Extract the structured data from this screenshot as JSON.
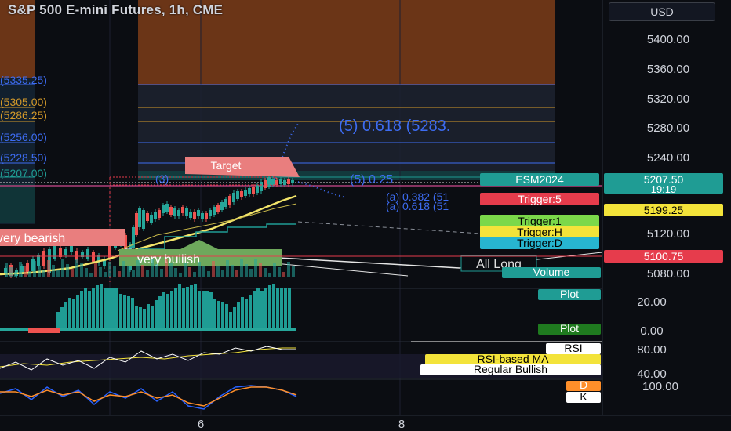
{
  "header": {
    "title": "S&P 500 E-mini Futures, 1h, CME",
    "currency_button": "USD"
  },
  "left_price_labels": [
    "(5335.25)",
    "(5305.00)",
    "(5286.25)",
    "(5256.00)",
    "(5228.50)",
    "(5207.00)"
  ],
  "fib_annotations": {
    "big_label": "(5) 0.618 (5283.",
    "cluster_label": "(3)",
    "label_025": "(5) 0.25",
    "label_a1": "(a) 0.382 (51",
    "label_a2": "(a) 0.618 (51"
  },
  "chart_labels": {
    "target": "Target",
    "very_bearish": "very bearish",
    "very_bullish": "very bullish",
    "all_long": "All Long"
  },
  "right_axis": {
    "price_ticks": [
      "5400.00",
      "5360.00",
      "5320.00",
      "5280.00",
      "5240.00",
      "5120.00",
      "5080.00"
    ],
    "indicator_ticks": [
      "20.00",
      "0.00"
    ],
    "rsi_ticks": [
      "80.00",
      "40.00"
    ],
    "stoch_ticks": [
      "100.00"
    ]
  },
  "right_badges": {
    "esm": "ESM2024",
    "esm_price": "5207.50",
    "countdown": "19:19",
    "trigger5": "Trigger:5",
    "price_yellow": "5199.25",
    "trigger1": "Trigger:1",
    "triggerH": "Trigger:H",
    "triggerD": "Trigger:D",
    "price_red": "5100.75",
    "volume": "Volume",
    "plot_top": "Plot",
    "plot_bottom": "Plot",
    "rsi": "RSI",
    "rsi_ma": "RSI-based MA",
    "regular_bullish": "Regular Bullish",
    "stoch_d": "D",
    "stoch_k": "K"
  },
  "time_axis": [
    "6",
    "8"
  ],
  "colors": {
    "background": "#0b0d12",
    "orange_zone": "#6b3517",
    "fib_blue": "#3d6cf2",
    "fib_orange": "#d49a2a",
    "teal": "#1f9c94",
    "red_badge": "#e63c4c",
    "yellow_badge": "#f3e33a",
    "green_badge": "#7bd84a",
    "cyan_badge": "#27b5d0",
    "yellow_ma": "#f2e46a",
    "salmon_label": "#e97e7e",
    "green_label": "#6ea85c"
  }
}
